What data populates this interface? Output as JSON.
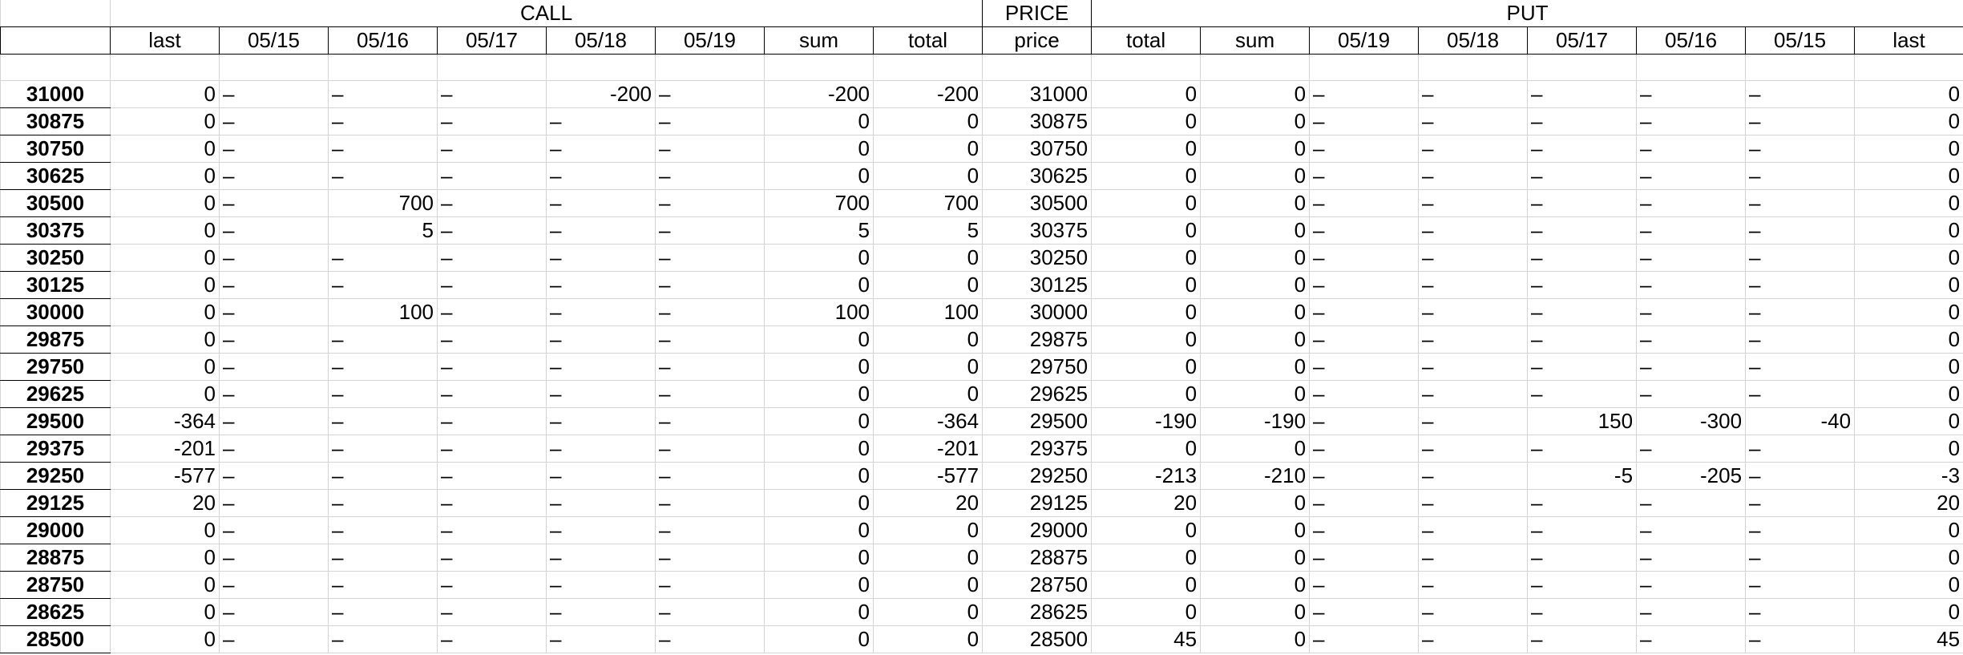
{
  "groups": {
    "call": "CALL",
    "price": "PRICE",
    "put": "PUT"
  },
  "headers": [
    "last",
    "05/15",
    "05/16",
    "05/17",
    "05/18",
    "05/19",
    "sum",
    "total",
    "price",
    "total",
    "sum",
    "05/19",
    "05/18",
    "05/17",
    "05/16",
    "05/15",
    "last"
  ],
  "rows": [
    {
      "label": "31000",
      "cells": [
        "0",
        "–",
        "–",
        "–",
        "-200",
        "–",
        "-200",
        "-200",
        "31000",
        "0",
        "0",
        "–",
        "–",
        "–",
        "–",
        "–",
        "0"
      ]
    },
    {
      "label": "30875",
      "cells": [
        "0",
        "–",
        "–",
        "–",
        "–",
        "–",
        "0",
        "0",
        "30875",
        "0",
        "0",
        "–",
        "–",
        "–",
        "–",
        "–",
        "0"
      ]
    },
    {
      "label": "30750",
      "cells": [
        "0",
        "–",
        "–",
        "–",
        "–",
        "–",
        "0",
        "0",
        "30750",
        "0",
        "0",
        "–",
        "–",
        "–",
        "–",
        "–",
        "0"
      ]
    },
    {
      "label": "30625",
      "cells": [
        "0",
        "–",
        "–",
        "–",
        "–",
        "–",
        "0",
        "0",
        "30625",
        "0",
        "0",
        "–",
        "–",
        "–",
        "–",
        "–",
        "0"
      ]
    },
    {
      "label": "30500",
      "cells": [
        "0",
        "–",
        "700",
        "–",
        "–",
        "–",
        "700",
        "700",
        "30500",
        "0",
        "0",
        "–",
        "–",
        "–",
        "–",
        "–",
        "0"
      ]
    },
    {
      "label": "30375",
      "cells": [
        "0",
        "–",
        "5",
        "–",
        "–",
        "–",
        "5",
        "5",
        "30375",
        "0",
        "0",
        "–",
        "–",
        "–",
        "–",
        "–",
        "0"
      ]
    },
    {
      "label": "30250",
      "cells": [
        "0",
        "–",
        "–",
        "–",
        "–",
        "–",
        "0",
        "0",
        "30250",
        "0",
        "0",
        "–",
        "–",
        "–",
        "–",
        "–",
        "0"
      ]
    },
    {
      "label": "30125",
      "cells": [
        "0",
        "–",
        "–",
        "–",
        "–",
        "–",
        "0",
        "0",
        "30125",
        "0",
        "0",
        "–",
        "–",
        "–",
        "–",
        "–",
        "0"
      ]
    },
    {
      "label": "30000",
      "cells": [
        "0",
        "–",
        "100",
        "–",
        "–",
        "–",
        "100",
        "100",
        "30000",
        "0",
        "0",
        "–",
        "–",
        "–",
        "–",
        "–",
        "0"
      ]
    },
    {
      "label": "29875",
      "cells": [
        "0",
        "–",
        "–",
        "–",
        "–",
        "–",
        "0",
        "0",
        "29875",
        "0",
        "0",
        "–",
        "–",
        "–",
        "–",
        "–",
        "0"
      ]
    },
    {
      "label": "29750",
      "cells": [
        "0",
        "–",
        "–",
        "–",
        "–",
        "–",
        "0",
        "0",
        "29750",
        "0",
        "0",
        "–",
        "–",
        "–",
        "–",
        "–",
        "0"
      ]
    },
    {
      "label": "29625",
      "cells": [
        "0",
        "–",
        "–",
        "–",
        "–",
        "–",
        "0",
        "0",
        "29625",
        "0",
        "0",
        "–",
        "–",
        "–",
        "–",
        "–",
        "0"
      ]
    },
    {
      "label": "29500",
      "cells": [
        "-364",
        "–",
        "–",
        "–",
        "–",
        "–",
        "0",
        "-364",
        "29500",
        "-190",
        "-190",
        "–",
        "–",
        "150",
        "-300",
        "-40",
        "0"
      ]
    },
    {
      "label": "29375",
      "cells": [
        "-201",
        "–",
        "–",
        "–",
        "–",
        "–",
        "0",
        "-201",
        "29375",
        "0",
        "0",
        "–",
        "–",
        "–",
        "–",
        "–",
        "0"
      ]
    },
    {
      "label": "29250",
      "cells": [
        "-577",
        "–",
        "–",
        "–",
        "–",
        "–",
        "0",
        "-577",
        "29250",
        "-213",
        "-210",
        "–",
        "–",
        "-5",
        "-205",
        "–",
        "-3"
      ]
    },
    {
      "label": "29125",
      "cells": [
        "20",
        "–",
        "–",
        "–",
        "–",
        "–",
        "0",
        "20",
        "29125",
        "20",
        "0",
        "–",
        "–",
        "–",
        "–",
        "–",
        "20"
      ]
    },
    {
      "label": "29000",
      "cells": [
        "0",
        "–",
        "–",
        "–",
        "–",
        "–",
        "0",
        "0",
        "29000",
        "0",
        "0",
        "–",
        "–",
        "–",
        "–",
        "–",
        "0"
      ]
    },
    {
      "label": "28875",
      "cells": [
        "0",
        "–",
        "–",
        "–",
        "–",
        "–",
        "0",
        "0",
        "28875",
        "0",
        "0",
        "–",
        "–",
        "–",
        "–",
        "–",
        "0"
      ]
    },
    {
      "label": "28750",
      "cells": [
        "0",
        "–",
        "–",
        "–",
        "–",
        "–",
        "0",
        "0",
        "28750",
        "0",
        "0",
        "–",
        "–",
        "–",
        "–",
        "–",
        "0"
      ]
    },
    {
      "label": "28625",
      "cells": [
        "0",
        "–",
        "–",
        "–",
        "–",
        "–",
        "0",
        "0",
        "28625",
        "0",
        "0",
        "–",
        "–",
        "–",
        "–",
        "–",
        "0"
      ]
    },
    {
      "label": "28500",
      "cells": [
        "0",
        "–",
        "–",
        "–",
        "–",
        "–",
        "0",
        "0",
        "28500",
        "45",
        "0",
        "–",
        "–",
        "–",
        "–",
        "–",
        "45"
      ]
    }
  ]
}
